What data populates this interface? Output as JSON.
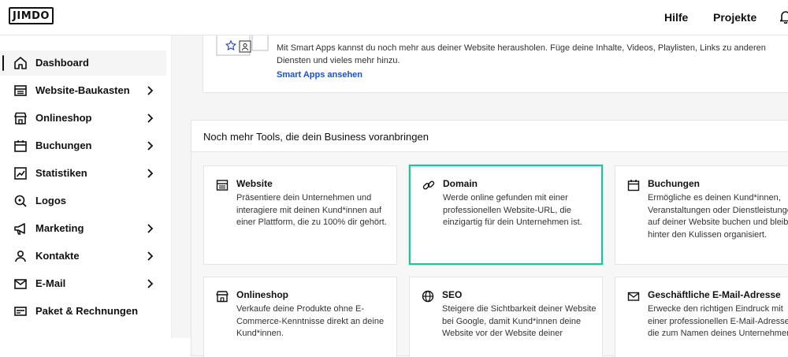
{
  "header": {
    "logo": "JIMDO",
    "help": "Hilfe",
    "projects": "Projekte"
  },
  "sidebar": {
    "items": [
      {
        "label": "Dashboard",
        "icon": "home-icon",
        "chevron": false,
        "active": true
      },
      {
        "label": "Website-Baukasten",
        "icon": "layout-icon",
        "chevron": true
      },
      {
        "label": "Onlineshop",
        "icon": "shop-icon",
        "chevron": true
      },
      {
        "label": "Buchungen",
        "icon": "calendar-icon",
        "chevron": true
      },
      {
        "label": "Statistiken",
        "icon": "chart-icon",
        "chevron": true
      },
      {
        "label": "Logos",
        "icon": "logo-search-icon",
        "chevron": false
      },
      {
        "label": "Marketing",
        "icon": "megaphone-icon",
        "chevron": true
      },
      {
        "label": "Kontakte",
        "icon": "person-icon",
        "chevron": true
      },
      {
        "label": "E-Mail",
        "icon": "mail-icon",
        "chevron": true
      },
      {
        "label": "Paket & Rechnungen",
        "icon": "billing-icon",
        "chevron": false
      }
    ]
  },
  "smart_apps": {
    "text": "Mit Smart Apps kannst du noch mehr aus deiner Website herausholen. Füge deine Inhalte, Videos, Playlisten, Links zu anderen Diensten und vieles mehr hinzu.",
    "link": "Smart Apps ansehen"
  },
  "tools": {
    "title": "Noch mehr Tools, die dein Business voranbringen",
    "tiles": [
      {
        "title": "Website",
        "icon": "layout-icon",
        "desc": "Präsentiere dein Unternehmen und interagiere mit deinen Kund*innen auf einer Plattform, die zu 100% dir gehört."
      },
      {
        "title": "Domain",
        "icon": "link-icon",
        "desc": "Werde online gefunden mit einer professionellen Website-URL, die einzigartig für dein Unternehmen ist."
      },
      {
        "title": "Buchungen",
        "icon": "calendar-icon",
        "desc": "Ermögliche es deinen Kund*innen, Veranstaltungen oder Dienstleistungen auf deiner Website buchen und bleibe hinter den Kulissen organisiert."
      },
      {
        "title": "Onlineshop",
        "icon": "shop-icon",
        "desc": "Verkaufe deine Produkte ohne E-Commerce-Kenntnisse direkt an deine Kund*innen."
      },
      {
        "title": "SEO",
        "icon": "globe-icon",
        "desc": "Steigere die Sichtbarkeit deiner Website bei Google, damit Kund*innen deine Website vor der Website deiner"
      },
      {
        "title": "Geschäftliche E-Mail-Adresse",
        "icon": "mail-icon",
        "desc": "Erwecke den richtigen Eindruck mit einer professionellen E-Mail-Adresse, die zum Namen deines Unternehmens"
      }
    ]
  }
}
